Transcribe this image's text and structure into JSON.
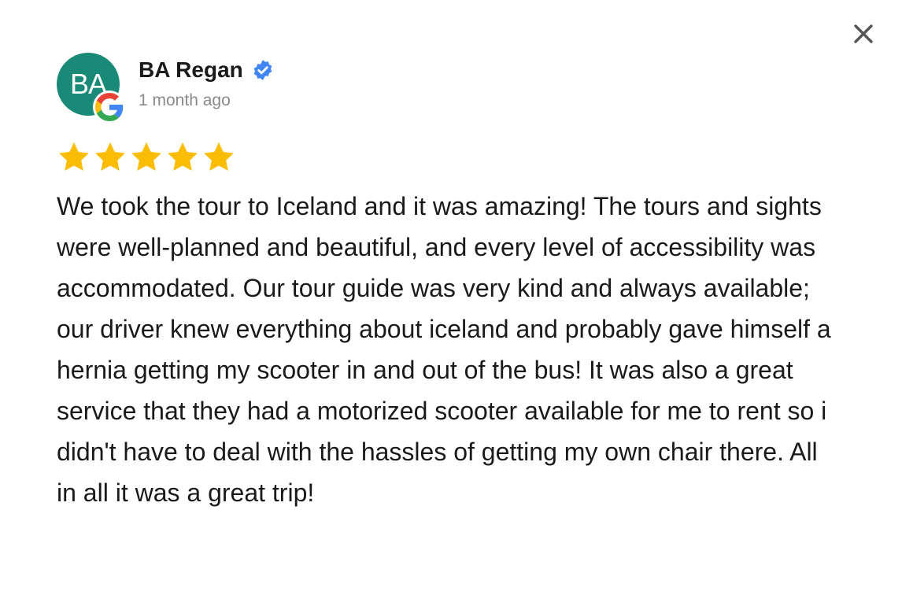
{
  "review": {
    "author_name": "BA Regan",
    "author_initials": "BA",
    "verified": true,
    "date": "1 month ago",
    "rating": 5,
    "rating_max": 5,
    "source_icon": "google-icon",
    "text": "We took the tour to Iceland and it was amazing! The tours and sights were well-planned and beautiful, and every level of accessibility was accommodated. Our tour guide was very kind and always available; our driver knew everything about iceland and probably gave himself a hernia getting my scooter in and out of the bus! It was also a great service that they had a motorized scooter available for me to rent so i didn't have to deal with the hassles of getting my own chair there. All in all it was a great trip!"
  },
  "controls": {
    "close_icon": "close-icon"
  },
  "colors": {
    "avatar_bg": "#1a8a78",
    "star": "#fbbc04",
    "verified": "#4285f4",
    "date_text": "#8a8a8a",
    "body_text": "#1a1a1a"
  }
}
